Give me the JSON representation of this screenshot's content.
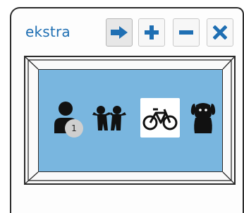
{
  "header": {
    "title": "ekstra"
  },
  "toolbar": {
    "buttons": [
      {
        "name": "next",
        "icon": "arrow-right-icon"
      },
      {
        "name": "add",
        "icon": "plus-icon"
      },
      {
        "name": "remove",
        "icon": "minus-icon"
      },
      {
        "name": "close",
        "icon": "close-icon"
      }
    ]
  },
  "grid": {
    "items": [
      {
        "icon": "person-icon",
        "badge": "1",
        "selected": false
      },
      {
        "icon": "children-icon",
        "selected": false
      },
      {
        "icon": "bicycle-icon",
        "selected": true
      },
      {
        "icon": "dog-icon",
        "selected": false
      }
    ]
  },
  "colors": {
    "accent": "#1f6fb3",
    "screen": "#79b6df",
    "icon": "#111111"
  }
}
